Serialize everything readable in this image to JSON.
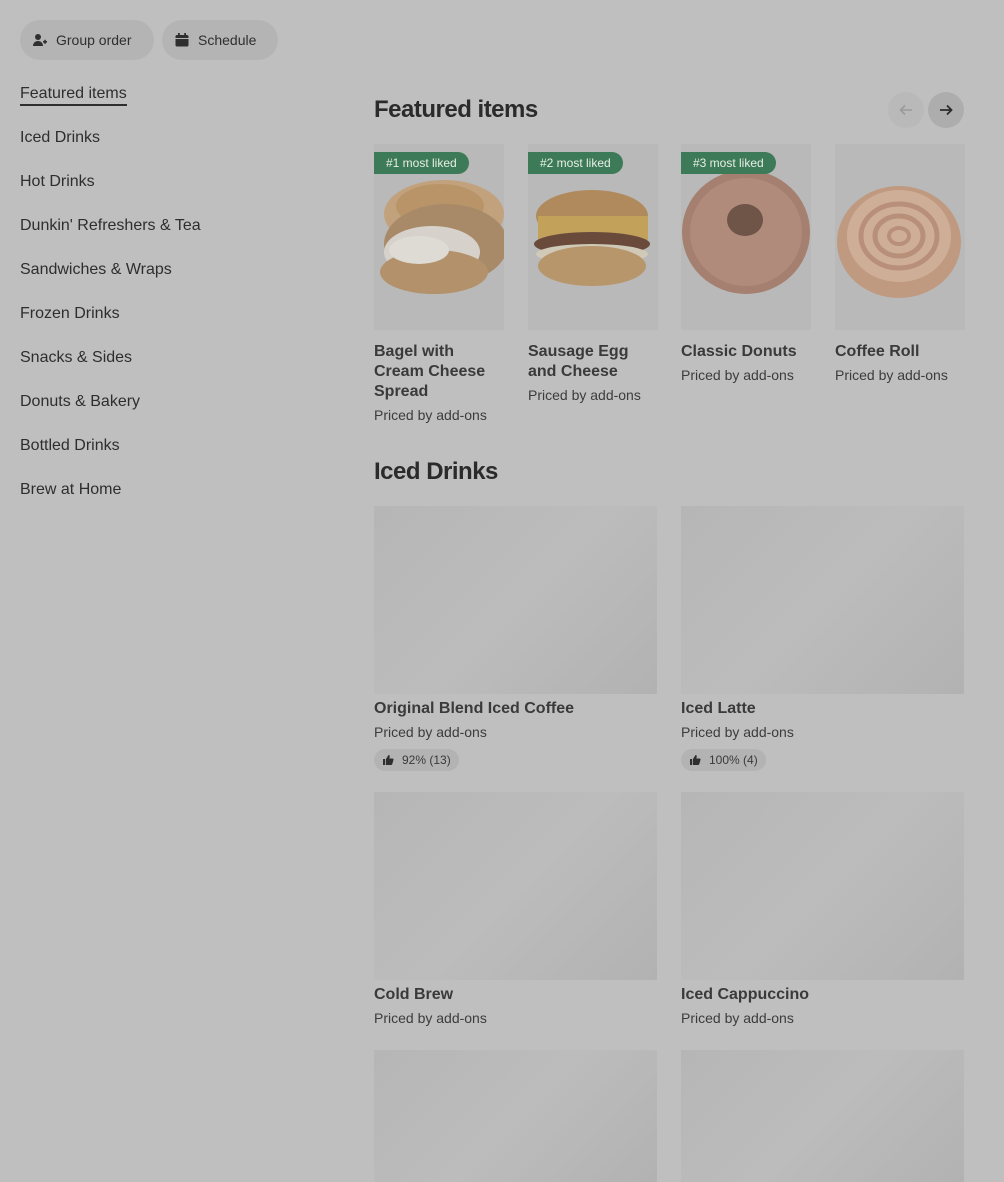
{
  "header": {
    "group_order_label": "Group order",
    "schedule_label": "Schedule"
  },
  "sidebar": {
    "items": [
      {
        "label": "Featured items"
      },
      {
        "label": "Iced Drinks"
      },
      {
        "label": "Hot Drinks"
      },
      {
        "label": "Dunkin' Refreshers & Tea"
      },
      {
        "label": "Sandwiches & Wraps"
      },
      {
        "label": "Frozen Drinks"
      },
      {
        "label": "Snacks & Sides"
      },
      {
        "label": "Donuts & Bakery"
      },
      {
        "label": "Bottled Drinks"
      },
      {
        "label": "Brew at Home"
      }
    ]
  },
  "featured": {
    "title": "Featured items",
    "items": [
      {
        "badge": "#1 most liked",
        "name": "Bagel with Cream Cheese Spread",
        "price": "Priced by add-ons"
      },
      {
        "badge": "#2 most liked",
        "name": "Sausage Egg and Cheese",
        "price": "Priced by add-ons"
      },
      {
        "badge": "#3 most liked",
        "name": "Classic Donuts",
        "price": "Priced by add-ons"
      },
      {
        "badge": "",
        "name": "Coffee Roll",
        "price": "Priced by add-ons"
      }
    ]
  },
  "iced": {
    "title": "Iced Drinks",
    "items": [
      {
        "name": "Original Blend Iced Coffee",
        "price": "Priced by add-ons",
        "rating": "92% (13)"
      },
      {
        "name": "Iced Latte",
        "price": "Priced by add-ons",
        "rating": "100% (4)"
      },
      {
        "name": "Cold Brew",
        "price": "Priced by add-ons",
        "rating": ""
      },
      {
        "name": "Iced Cappuccino",
        "price": "Priced by add-ons",
        "rating": ""
      }
    ]
  },
  "colors": {
    "badge_green": "#3d7a57",
    "overlay_gray": "#bfbfbf"
  }
}
